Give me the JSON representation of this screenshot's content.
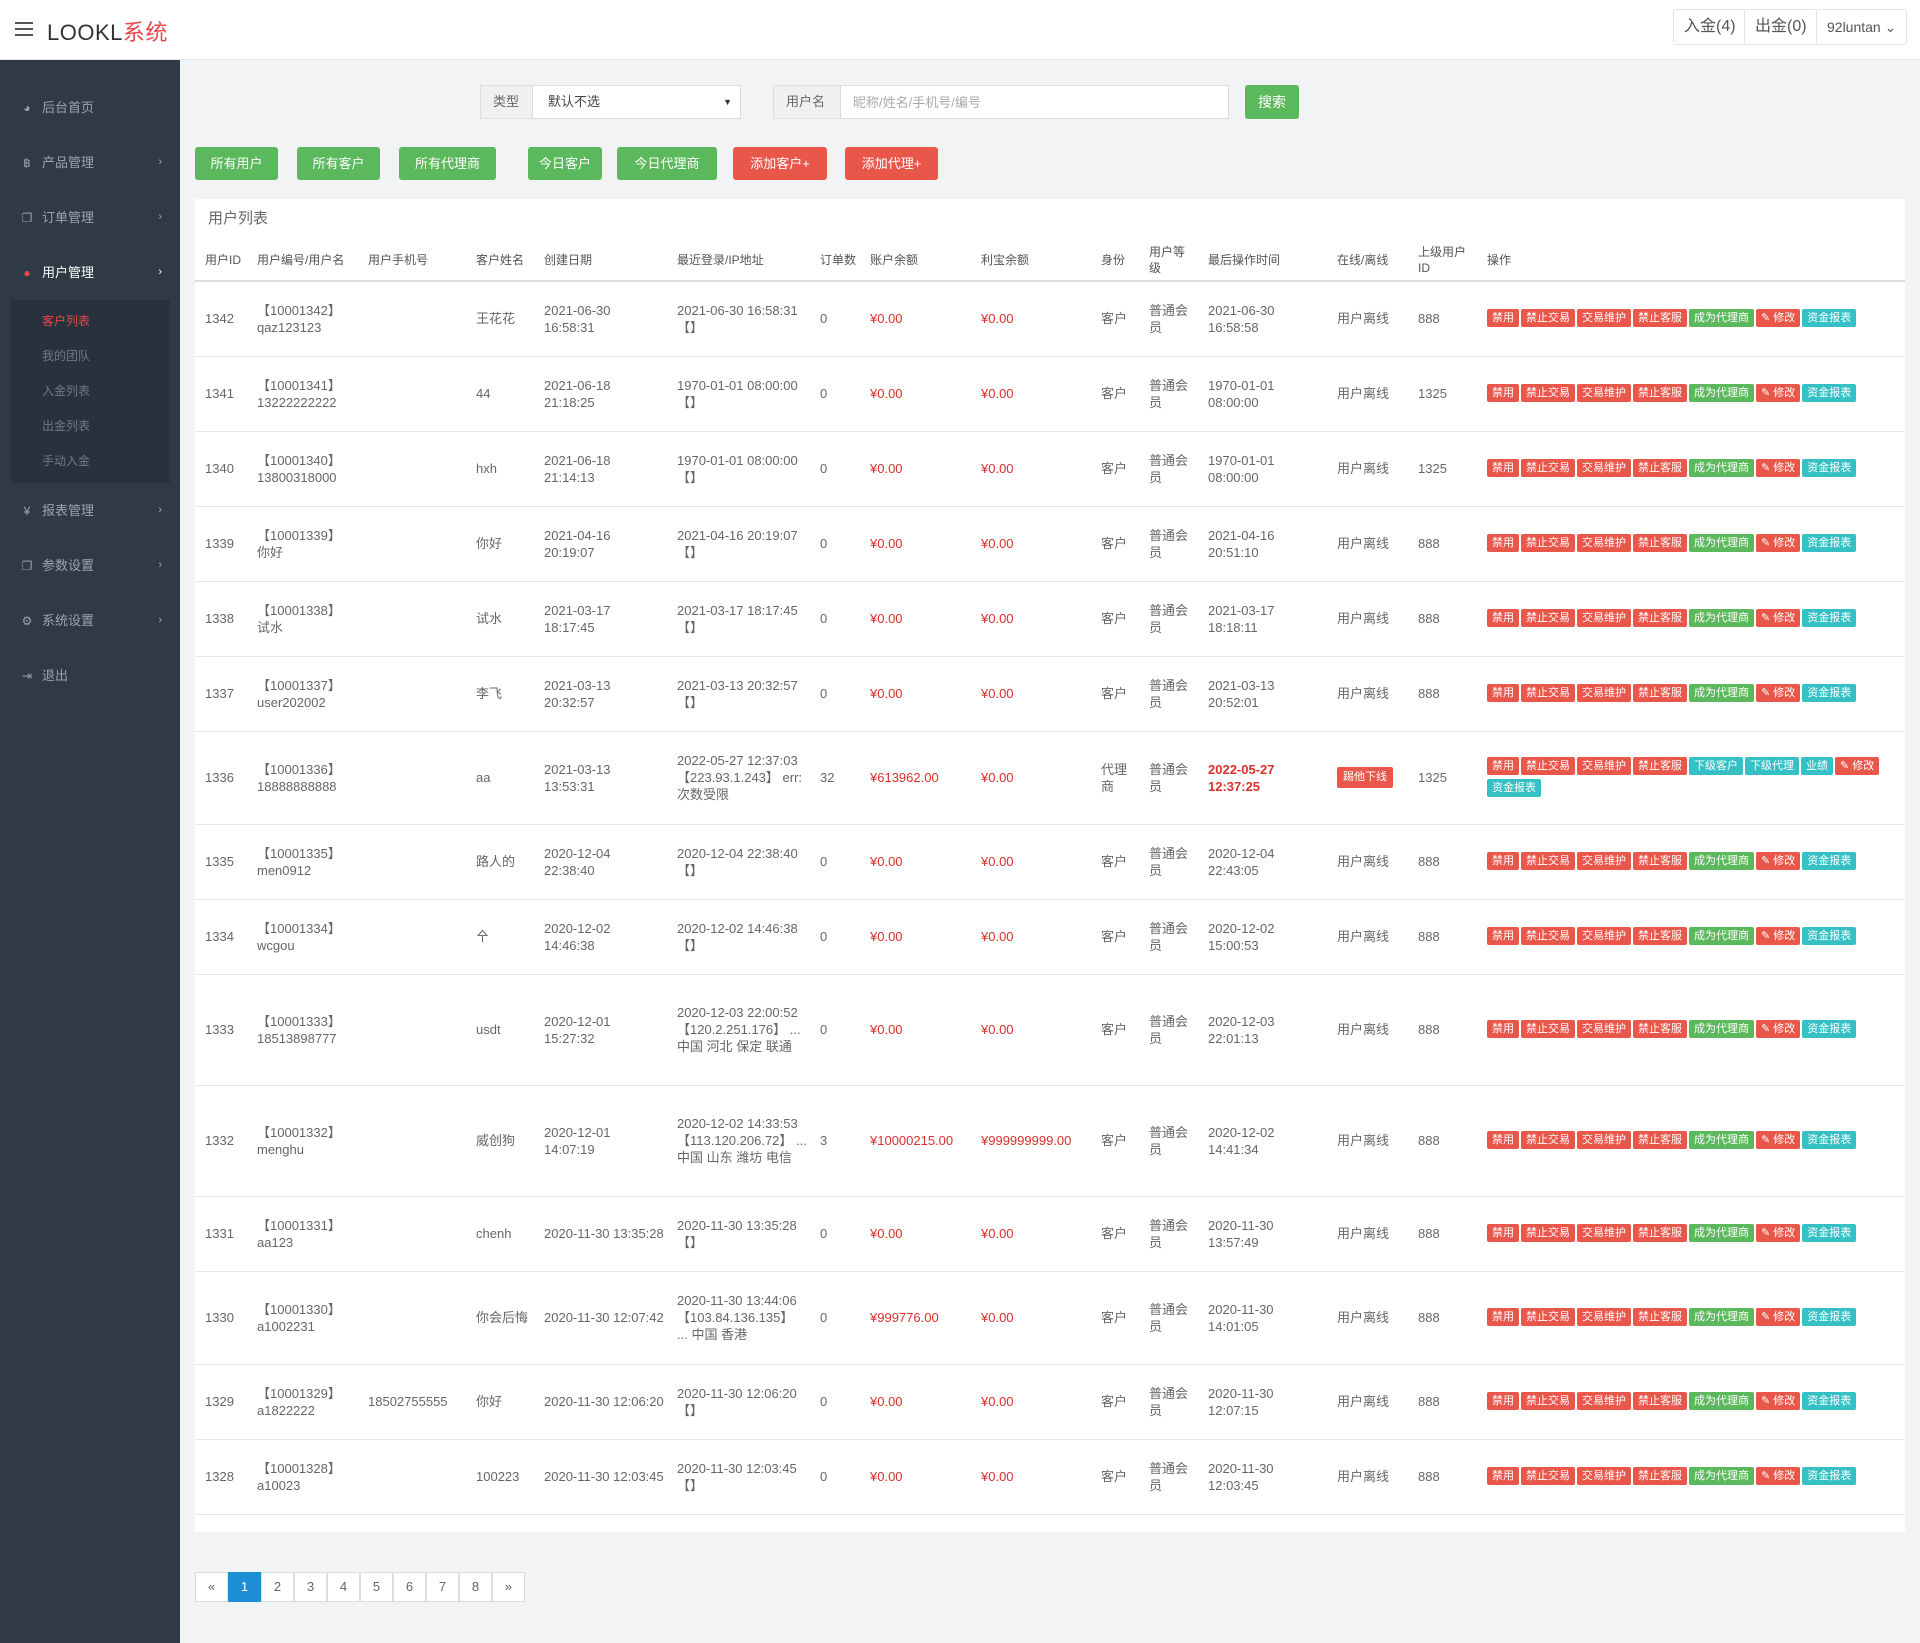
{
  "app": {
    "brand_main": "LOOKL",
    "brand_sub": "系统"
  },
  "header": {
    "deposit_btn": "入金(4)",
    "withdraw_btn": "出金(0)",
    "user_btn": "92luntan ⌄"
  },
  "sidebar": {
    "items": [
      {
        "label": "后台首页",
        "icon": "dashboard-icon",
        "glyph": "◕",
        "arrow": ""
      },
      {
        "label": "产品管理",
        "icon": "bitcoin-icon",
        "glyph": "฿",
        "arrow": "›"
      },
      {
        "label": "订单管理",
        "icon": "copy-icon",
        "glyph": "❐",
        "arrow": "›"
      },
      {
        "label": "用户管理",
        "icon": "user-icon",
        "glyph": "●",
        "arrow": "›"
      },
      {
        "label": "报表管理",
        "icon": "yen-icon",
        "glyph": "¥",
        "arrow": "›"
      },
      {
        "label": "参数设置",
        "icon": "copy-icon",
        "glyph": "❐",
        "arrow": "›"
      },
      {
        "label": "系统设置",
        "icon": "cogs-icon",
        "glyph": "⚙",
        "arrow": "›"
      },
      {
        "label": "退出",
        "icon": "signout-icon",
        "glyph": "⇥",
        "arrow": ""
      }
    ],
    "sub_items": [
      "客户列表",
      "我的团队",
      "入金列表",
      "出金列表",
      "手动入金"
    ]
  },
  "search": {
    "type_label": "类型",
    "type_value": "默认不选",
    "type_caret": "▼",
    "name_label": "用户名",
    "name_placeholder": "昵称/姓名/手机号/编号",
    "search_btn": "搜索"
  },
  "filters": [
    "所有用户",
    "所有客户",
    "所有代理商",
    "今日客户",
    "今日代理商",
    "添加客户+",
    "添加代理+"
  ],
  "panel": {
    "title": "用户列表"
  },
  "table": {
    "headers": [
      "用户ID",
      "用户编号/用户名",
      "用户手机号",
      "客户姓名",
      "创建日期",
      "最近登录/IP地址",
      "订单数",
      "账户余额",
      "利宝余额",
      "身份",
      "用户等级",
      "最后操作时间",
      "在线/离线",
      "上级用户ID",
      "操作"
    ],
    "rows": [
      {
        "id": "1342",
        "code": "【10001342】",
        "username": "qaz123123",
        "phone": "",
        "name": "王花花",
        "created": "2021-06-30 16:58:31",
        "login": "2021-06-30 16:58:31 【】",
        "orders": "0",
        "balance": "¥0.00",
        "libao": "¥0.00",
        "role": "客户",
        "level": "普通会员",
        "last_op": "2021-06-30 16:58:58",
        "online": "用户离线",
        "parent": "888",
        "actions": [
          [
            "禁用",
            "r"
          ],
          [
            "禁止交易",
            "r"
          ],
          [
            "交易维护",
            "r"
          ],
          [
            "禁止客服",
            "r"
          ],
          [
            "成为代理商",
            "g"
          ],
          [
            "✎ 修改",
            "r"
          ],
          [
            "资金报表",
            "c"
          ]
        ]
      },
      {
        "id": "1341",
        "code": "【10001341】",
        "username": "13222222222",
        "phone": "",
        "name": "44",
        "created": "2021-06-18 21:18:25",
        "login": "1970-01-01 08:00:00 【】",
        "orders": "0",
        "balance": "¥0.00",
        "libao": "¥0.00",
        "role": "客户",
        "level": "普通会员",
        "last_op": "1970-01-01 08:00:00",
        "online": "用户离线",
        "parent": "1325",
        "actions": [
          [
            "禁用",
            "r"
          ],
          [
            "禁止交易",
            "r"
          ],
          [
            "交易维护",
            "r"
          ],
          [
            "禁止客服",
            "r"
          ],
          [
            "成为代理商",
            "g"
          ],
          [
            "✎ 修改",
            "r"
          ],
          [
            "资金报表",
            "c"
          ]
        ]
      },
      {
        "id": "1340",
        "code": "【10001340】",
        "username": "13800318000",
        "phone": "",
        "name": "hxh",
        "created": "2021-06-18 21:14:13",
        "login": "1970-01-01 08:00:00 【】",
        "orders": "0",
        "balance": "¥0.00",
        "libao": "¥0.00",
        "role": "客户",
        "level": "普通会员",
        "last_op": "1970-01-01 08:00:00",
        "online": "用户离线",
        "parent": "1325",
        "actions": [
          [
            "禁用",
            "r"
          ],
          [
            "禁止交易",
            "r"
          ],
          [
            "交易维护",
            "r"
          ],
          [
            "禁止客服",
            "r"
          ],
          [
            "成为代理商",
            "g"
          ],
          [
            "✎ 修改",
            "r"
          ],
          [
            "资金报表",
            "c"
          ]
        ]
      },
      {
        "id": "1339",
        "code": "【10001339】",
        "username": "你好",
        "phone": "",
        "name": "你好",
        "created": "2021-04-16 20:19:07",
        "login": "2021-04-16 20:19:07 【】",
        "orders": "0",
        "balance": "¥0.00",
        "libao": "¥0.00",
        "role": "客户",
        "level": "普通会员",
        "last_op": "2021-04-16 20:51:10",
        "online": "用户离线",
        "parent": "888",
        "actions": [
          [
            "禁用",
            "r"
          ],
          [
            "禁止交易",
            "r"
          ],
          [
            "交易维护",
            "r"
          ],
          [
            "禁止客服",
            "r"
          ],
          [
            "成为代理商",
            "g"
          ],
          [
            "✎ 修改",
            "r"
          ],
          [
            "资金报表",
            "c"
          ]
        ]
      },
      {
        "id": "1338",
        "code": "【10001338】",
        "username": "试水",
        "phone": "",
        "name": "试水",
        "created": "2021-03-17 18:17:45",
        "login": "2021-03-17 18:17:45 【】",
        "orders": "0",
        "balance": "¥0.00",
        "libao": "¥0.00",
        "role": "客户",
        "level": "普通会员",
        "last_op": "2021-03-17 18:18:11",
        "online": "用户离线",
        "parent": "888",
        "actions": [
          [
            "禁用",
            "r"
          ],
          [
            "禁止交易",
            "r"
          ],
          [
            "交易维护",
            "r"
          ],
          [
            "禁止客服",
            "r"
          ],
          [
            "成为代理商",
            "g"
          ],
          [
            "✎ 修改",
            "r"
          ],
          [
            "资金报表",
            "c"
          ]
        ]
      },
      {
        "id": "1337",
        "code": "【10001337】",
        "username": "user202002",
        "phone": "",
        "name": "李飞",
        "created": "2021-03-13 20:32:57",
        "login": "2021-03-13 20:32:57 【】",
        "orders": "0",
        "balance": "¥0.00",
        "libao": "¥0.00",
        "role": "客户",
        "level": "普通会员",
        "last_op": "2021-03-13 20:52:01",
        "online": "用户离线",
        "parent": "888",
        "actions": [
          [
            "禁用",
            "r"
          ],
          [
            "禁止交易",
            "r"
          ],
          [
            "交易维护",
            "r"
          ],
          [
            "禁止客服",
            "r"
          ],
          [
            "成为代理商",
            "g"
          ],
          [
            "✎ 修改",
            "r"
          ],
          [
            "资金报表",
            "c"
          ]
        ]
      },
      {
        "id": "1336",
        "code": "【10001336】",
        "username": "18888888888",
        "phone": "",
        "name": "aa",
        "created": "2021-03-13 13:53:31",
        "login": "2022-05-27 12:37:03 【223.93.1.243】 err:次数受限",
        "orders": "32",
        "balance": "¥613962.00",
        "libao": "¥0.00",
        "role": "代理商",
        "level": "普通会员",
        "last_op": "2022-05-27 12:37:25",
        "last_op_bold": true,
        "online": "踢他下线",
        "online_tag": true,
        "parent": "1325",
        "actions": [
          [
            "禁用",
            "r"
          ],
          [
            "禁止交易",
            "r"
          ],
          [
            "交易维护",
            "r"
          ],
          [
            "禁止客服",
            "r"
          ],
          [
            "下级客户",
            "c"
          ],
          [
            "下级代理",
            "c"
          ],
          [
            "业绩",
            "c"
          ],
          [
            "✎ 修改",
            "r"
          ],
          [
            "资金报表",
            "c"
          ]
        ]
      },
      {
        "id": "1335",
        "code": "【10001335】",
        "username": "men0912",
        "phone": "",
        "name": "路人的",
        "created": "2020-12-04 22:38:40",
        "login": "2020-12-04 22:38:40 【】",
        "orders": "0",
        "balance": "¥0.00",
        "libao": "¥0.00",
        "role": "客户",
        "level": "普通会员",
        "last_op": "2020-12-04 22:43:05",
        "online": "用户离线",
        "parent": "888",
        "actions": [
          [
            "禁用",
            "r"
          ],
          [
            "禁止交易",
            "r"
          ],
          [
            "交易维护",
            "r"
          ],
          [
            "禁止客服",
            "r"
          ],
          [
            "成为代理商",
            "g"
          ],
          [
            "✎ 修改",
            "r"
          ],
          [
            "资金报表",
            "c"
          ]
        ]
      },
      {
        "id": "1334",
        "code": "【10001334】",
        "username": "wcgou",
        "phone": "",
        "name": "㐃",
        "created": "2020-12-02 14:46:38",
        "login": "2020-12-02 14:46:38 【】",
        "orders": "0",
        "balance": "¥0.00",
        "libao": "¥0.00",
        "role": "客户",
        "level": "普通会员",
        "last_op": "2020-12-02 15:00:53",
        "online": "用户离线",
        "parent": "888",
        "actions": [
          [
            "禁用",
            "r"
          ],
          [
            "禁止交易",
            "r"
          ],
          [
            "交易维护",
            "r"
          ],
          [
            "禁止客服",
            "r"
          ],
          [
            "成为代理商",
            "g"
          ],
          [
            "✎ 修改",
            "r"
          ],
          [
            "资金报表",
            "c"
          ]
        ]
      },
      {
        "id": "1333",
        "code": "【10001333】",
        "username": "18513898777",
        "phone": "",
        "name": "usdt",
        "created": "2020-12-01 15:27:32",
        "login": "2020-12-03 22:00:52 【120.2.251.176】 ... 中国 河北 保定 联通",
        "orders": "0",
        "balance": "¥0.00",
        "libao": "¥0.00",
        "role": "客户",
        "level": "普通会员",
        "last_op": "2020-12-03 22:01:13",
        "online": "用户离线",
        "parent": "888",
        "actions": [
          [
            "禁用",
            "r"
          ],
          [
            "禁止交易",
            "r"
          ],
          [
            "交易维护",
            "r"
          ],
          [
            "禁止客服",
            "r"
          ],
          [
            "成为代理商",
            "g"
          ],
          [
            "✎ 修改",
            "r"
          ],
          [
            "资金报表",
            "c"
          ]
        ]
      },
      {
        "id": "1332",
        "code": "【10001332】",
        "username": "menghu",
        "phone": "",
        "name": "威创狗",
        "created": "2020-12-01 14:07:19",
        "login": "2020-12-02 14:33:53 【113.120.206.72】 ... 中国 山东 潍坊 电信",
        "orders": "3",
        "balance": "¥10000215.00",
        "libao": "¥999999999.00",
        "role": "客户",
        "level": "普通会员",
        "last_op": "2020-12-02 14:41:34",
        "online": "用户离线",
        "parent": "888",
        "actions": [
          [
            "禁用",
            "r"
          ],
          [
            "禁止交易",
            "r"
          ],
          [
            "交易维护",
            "r"
          ],
          [
            "禁止客服",
            "r"
          ],
          [
            "成为代理商",
            "g"
          ],
          [
            "✎ 修改",
            "r"
          ],
          [
            "资金报表",
            "c"
          ]
        ]
      },
      {
        "id": "1331",
        "code": "【10001331】",
        "username": "aa123",
        "phone": "",
        "name": "chenh",
        "created": "2020-11-30 13:35:28",
        "login": "2020-11-30 13:35:28 【】",
        "orders": "0",
        "balance": "¥0.00",
        "libao": "¥0.00",
        "role": "客户",
        "level": "普通会员",
        "last_op": "2020-11-30 13:57:49",
        "online": "用户离线",
        "parent": "888",
        "actions": [
          [
            "禁用",
            "r"
          ],
          [
            "禁止交易",
            "r"
          ],
          [
            "交易维护",
            "r"
          ],
          [
            "禁止客服",
            "r"
          ],
          [
            "成为代理商",
            "g"
          ],
          [
            "✎ 修改",
            "r"
          ],
          [
            "资金报表",
            "c"
          ]
        ]
      },
      {
        "id": "1330",
        "code": "【10001330】",
        "username": "a1002231",
        "phone": "",
        "name": "你会后悔",
        "created": "2020-11-30 12:07:42",
        "login": "2020-11-30 13:44:06 【103.84.136.135】 ... 中国 香港",
        "orders": "0",
        "balance": "¥999776.00",
        "libao": "¥0.00",
        "role": "客户",
        "level": "普通会员",
        "last_op": "2020-11-30 14:01:05",
        "online": "用户离线",
        "parent": "888",
        "actions": [
          [
            "禁用",
            "r"
          ],
          [
            "禁止交易",
            "r"
          ],
          [
            "交易维护",
            "r"
          ],
          [
            "禁止客服",
            "r"
          ],
          [
            "成为代理商",
            "g"
          ],
          [
            "✎ 修改",
            "r"
          ],
          [
            "资金报表",
            "c"
          ]
        ]
      },
      {
        "id": "1329",
        "code": "【10001329】",
        "username": "a1822222",
        "phone": "18502755555",
        "name": "你好",
        "created": "2020-11-30 12:06:20",
        "login": "2020-11-30 12:06:20 【】",
        "orders": "0",
        "balance": "¥0.00",
        "libao": "¥0.00",
        "role": "客户",
        "level": "普通会员",
        "last_op": "2020-11-30 12:07:15",
        "online": "用户离线",
        "parent": "888",
        "actions": [
          [
            "禁用",
            "r"
          ],
          [
            "禁止交易",
            "r"
          ],
          [
            "交易维护",
            "r"
          ],
          [
            "禁止客服",
            "r"
          ],
          [
            "成为代理商",
            "g"
          ],
          [
            "✎ 修改",
            "r"
          ],
          [
            "资金报表",
            "c"
          ]
        ]
      },
      {
        "id": "1328",
        "code": "【10001328】",
        "username": "a10023",
        "phone": "",
        "name": "100223",
        "created": "2020-11-30 12:03:45",
        "login": "2020-11-30 12:03:45 【】",
        "orders": "0",
        "balance": "¥0.00",
        "libao": "¥0.00",
        "role": "客户",
        "level": "普通会员",
        "last_op": "2020-11-30 12:03:45",
        "online": "用户离线",
        "parent": "888",
        "actions": [
          [
            "禁用",
            "r"
          ],
          [
            "禁止交易",
            "r"
          ],
          [
            "交易维护",
            "r"
          ],
          [
            "禁止客服",
            "r"
          ],
          [
            "成为代理商",
            "g"
          ],
          [
            "✎ 修改",
            "r"
          ],
          [
            "资金报表",
            "c"
          ]
        ]
      }
    ]
  },
  "pagination": {
    "prev": "«",
    "pages": [
      "1",
      "2",
      "3",
      "4",
      "5",
      "6",
      "7",
      "8"
    ],
    "next": "»",
    "current": "1"
  }
}
